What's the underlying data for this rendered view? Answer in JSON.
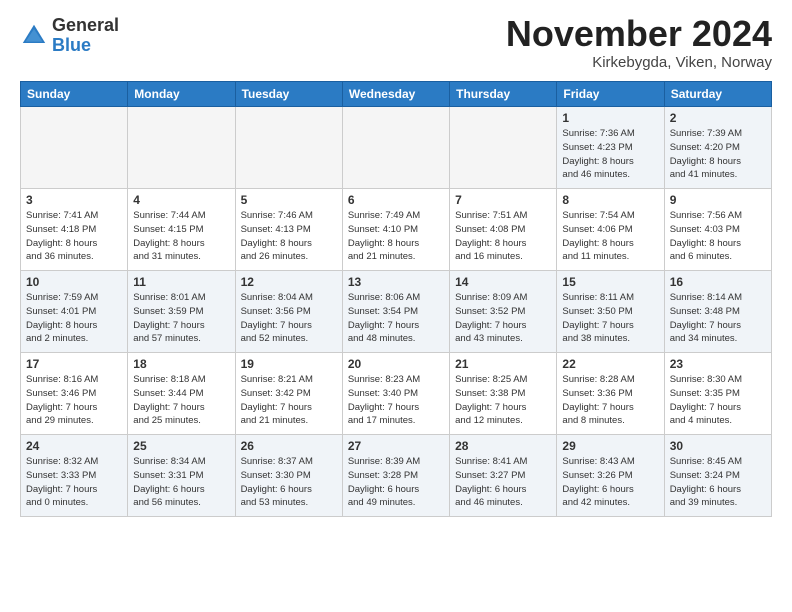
{
  "header": {
    "logo_general": "General",
    "logo_blue": "Blue",
    "month_title": "November 2024",
    "location": "Kirkebygda, Viken, Norway"
  },
  "weekdays": [
    "Sunday",
    "Monday",
    "Tuesday",
    "Wednesday",
    "Thursday",
    "Friday",
    "Saturday"
  ],
  "weeks": [
    [
      {
        "day": "",
        "info": ""
      },
      {
        "day": "",
        "info": ""
      },
      {
        "day": "",
        "info": ""
      },
      {
        "day": "",
        "info": ""
      },
      {
        "day": "",
        "info": ""
      },
      {
        "day": "1",
        "info": "Sunrise: 7:36 AM\nSunset: 4:23 PM\nDaylight: 8 hours\nand 46 minutes."
      },
      {
        "day": "2",
        "info": "Sunrise: 7:39 AM\nSunset: 4:20 PM\nDaylight: 8 hours\nand 41 minutes."
      }
    ],
    [
      {
        "day": "3",
        "info": "Sunrise: 7:41 AM\nSunset: 4:18 PM\nDaylight: 8 hours\nand 36 minutes."
      },
      {
        "day": "4",
        "info": "Sunrise: 7:44 AM\nSunset: 4:15 PM\nDaylight: 8 hours\nand 31 minutes."
      },
      {
        "day": "5",
        "info": "Sunrise: 7:46 AM\nSunset: 4:13 PM\nDaylight: 8 hours\nand 26 minutes."
      },
      {
        "day": "6",
        "info": "Sunrise: 7:49 AM\nSunset: 4:10 PM\nDaylight: 8 hours\nand 21 minutes."
      },
      {
        "day": "7",
        "info": "Sunrise: 7:51 AM\nSunset: 4:08 PM\nDaylight: 8 hours\nand 16 minutes."
      },
      {
        "day": "8",
        "info": "Sunrise: 7:54 AM\nSunset: 4:06 PM\nDaylight: 8 hours\nand 11 minutes."
      },
      {
        "day": "9",
        "info": "Sunrise: 7:56 AM\nSunset: 4:03 PM\nDaylight: 8 hours\nand 6 minutes."
      }
    ],
    [
      {
        "day": "10",
        "info": "Sunrise: 7:59 AM\nSunset: 4:01 PM\nDaylight: 8 hours\nand 2 minutes."
      },
      {
        "day": "11",
        "info": "Sunrise: 8:01 AM\nSunset: 3:59 PM\nDaylight: 7 hours\nand 57 minutes."
      },
      {
        "day": "12",
        "info": "Sunrise: 8:04 AM\nSunset: 3:56 PM\nDaylight: 7 hours\nand 52 minutes."
      },
      {
        "day": "13",
        "info": "Sunrise: 8:06 AM\nSunset: 3:54 PM\nDaylight: 7 hours\nand 48 minutes."
      },
      {
        "day": "14",
        "info": "Sunrise: 8:09 AM\nSunset: 3:52 PM\nDaylight: 7 hours\nand 43 minutes."
      },
      {
        "day": "15",
        "info": "Sunrise: 8:11 AM\nSunset: 3:50 PM\nDaylight: 7 hours\nand 38 minutes."
      },
      {
        "day": "16",
        "info": "Sunrise: 8:14 AM\nSunset: 3:48 PM\nDaylight: 7 hours\nand 34 minutes."
      }
    ],
    [
      {
        "day": "17",
        "info": "Sunrise: 8:16 AM\nSunset: 3:46 PM\nDaylight: 7 hours\nand 29 minutes."
      },
      {
        "day": "18",
        "info": "Sunrise: 8:18 AM\nSunset: 3:44 PM\nDaylight: 7 hours\nand 25 minutes."
      },
      {
        "day": "19",
        "info": "Sunrise: 8:21 AM\nSunset: 3:42 PM\nDaylight: 7 hours\nand 21 minutes."
      },
      {
        "day": "20",
        "info": "Sunrise: 8:23 AM\nSunset: 3:40 PM\nDaylight: 7 hours\nand 17 minutes."
      },
      {
        "day": "21",
        "info": "Sunrise: 8:25 AM\nSunset: 3:38 PM\nDaylight: 7 hours\nand 12 minutes."
      },
      {
        "day": "22",
        "info": "Sunrise: 8:28 AM\nSunset: 3:36 PM\nDaylight: 7 hours\nand 8 minutes."
      },
      {
        "day": "23",
        "info": "Sunrise: 8:30 AM\nSunset: 3:35 PM\nDaylight: 7 hours\nand 4 minutes."
      }
    ],
    [
      {
        "day": "24",
        "info": "Sunrise: 8:32 AM\nSunset: 3:33 PM\nDaylight: 7 hours\nand 0 minutes."
      },
      {
        "day": "25",
        "info": "Sunrise: 8:34 AM\nSunset: 3:31 PM\nDaylight: 6 hours\nand 56 minutes."
      },
      {
        "day": "26",
        "info": "Sunrise: 8:37 AM\nSunset: 3:30 PM\nDaylight: 6 hours\nand 53 minutes."
      },
      {
        "day": "27",
        "info": "Sunrise: 8:39 AM\nSunset: 3:28 PM\nDaylight: 6 hours\nand 49 minutes."
      },
      {
        "day": "28",
        "info": "Sunrise: 8:41 AM\nSunset: 3:27 PM\nDaylight: 6 hours\nand 46 minutes."
      },
      {
        "day": "29",
        "info": "Sunrise: 8:43 AM\nSunset: 3:26 PM\nDaylight: 6 hours\nand 42 minutes."
      },
      {
        "day": "30",
        "info": "Sunrise: 8:45 AM\nSunset: 3:24 PM\nDaylight: 6 hours\nand 39 minutes."
      }
    ]
  ]
}
